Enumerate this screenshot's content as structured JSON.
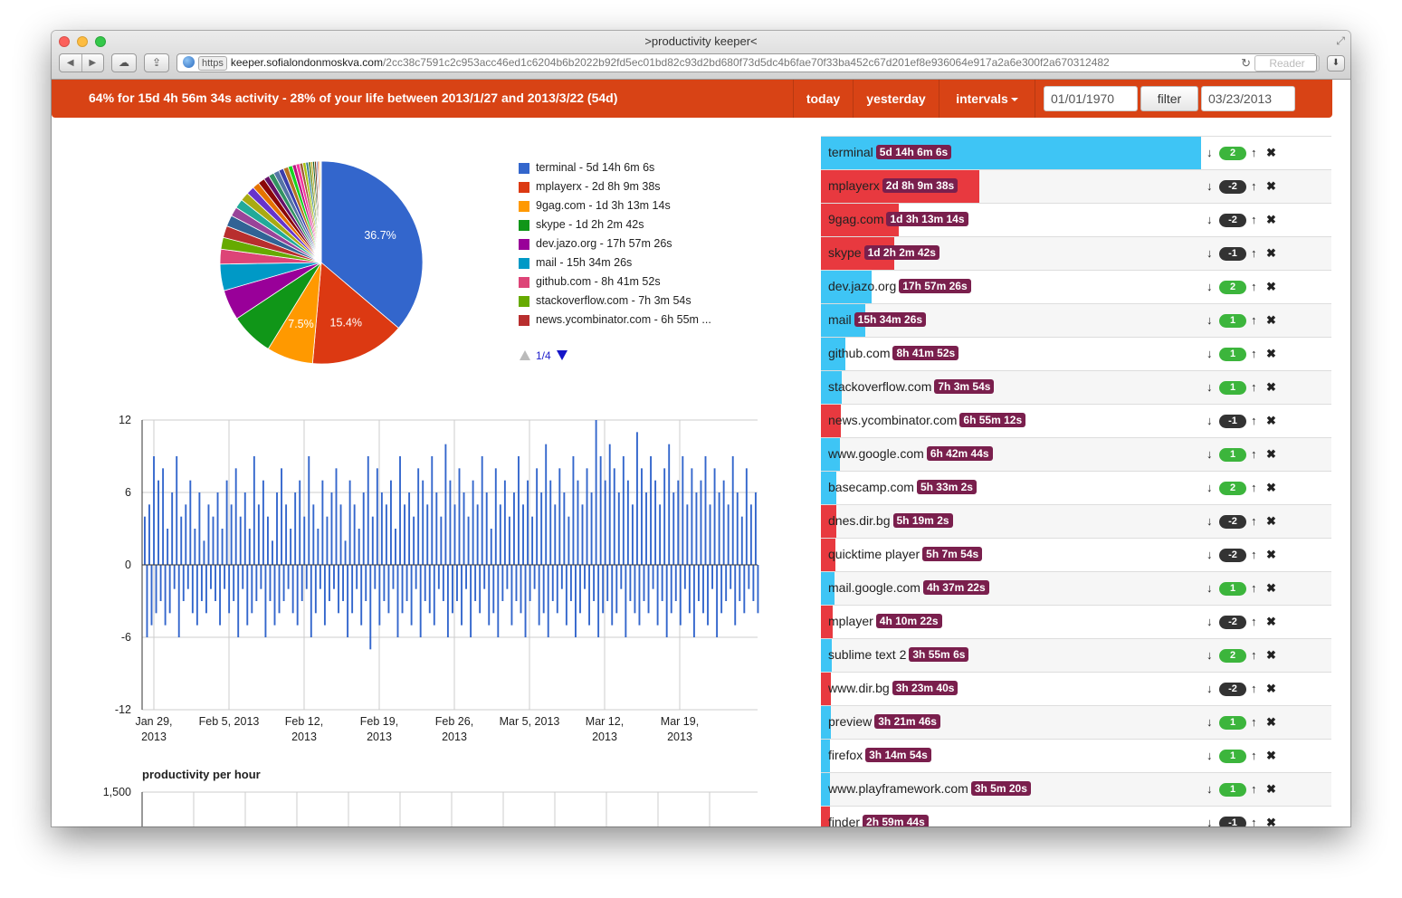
{
  "window": {
    "title": ">productivity keeper<",
    "url_https": "https",
    "url_host": "keeper.sofialondonmoskva.com",
    "url_path": "/2cc38c7591c2c953acc46ed1c6204b6b2022b92fd5ec01bd82c93d2bd680f73d5dc4b6fae70f33ba452c67d201ef8e936064e917a2a6e300f2a670312482",
    "reader": "Reader"
  },
  "topbar": {
    "summary": "64% for 15d 4h 56m 34s activity - 28% of your life between 2013/1/27 and 2013/3/22 (54d)",
    "today": "today",
    "yesterday": "yesterday",
    "intervals": "intervals",
    "from": "01/01/1970",
    "filter": "filter",
    "to": "03/23/2013"
  },
  "colors": {
    "brand": "#d84315",
    "productive": "#3ec5f5",
    "unproductive": "#e8393f",
    "duration_badge": "#7a1f4d",
    "score_positive": "#3cb53c",
    "score_negative": "#333333"
  },
  "chart_data": [
    {
      "type": "pie",
      "slices": [
        {
          "label": "terminal - 5d 14h 6m 6s",
          "value": 36.7,
          "color": "#3366cc",
          "show": "36.7%"
        },
        {
          "label": "mplayerx - 2d 8h 9m 38s",
          "value": 15.4,
          "color": "#dc3912",
          "show": "15.4%"
        },
        {
          "label": "9gag.com - 1d 3h 13m 14s",
          "value": 7.5,
          "color": "#ff9900",
          "show": "7.5%"
        },
        {
          "label": "skype - 1d 2h 2m 42s",
          "value": 7.0,
          "color": "#109618",
          "show": ""
        },
        {
          "label": "dev.jazo.org - 17h 57m 26s",
          "value": 4.9,
          "color": "#990099",
          "show": ""
        },
        {
          "label": "mail - 15h 34m 26s",
          "value": 4.3,
          "color": "#0099c6",
          "show": ""
        },
        {
          "label": "github.com - 8h 41m 52s",
          "value": 2.4,
          "color": "#dd4477",
          "show": ""
        },
        {
          "label": "stackoverflow.com - 7h 3m 54s",
          "value": 1.9,
          "color": "#66aa00",
          "show": ""
        },
        {
          "label": "news.ycombinator.com - 6h 55m ...",
          "value": 1.9,
          "color": "#b82e2e",
          "show": ""
        },
        {
          "label": "www.google.com",
          "value": 1.8,
          "color": "#316395",
          "show": ""
        },
        {
          "label": "basecamp.com",
          "value": 1.5,
          "color": "#994499",
          "show": ""
        },
        {
          "label": "dnes.dir.bg",
          "value": 1.5,
          "color": "#22aa99",
          "show": ""
        },
        {
          "label": "quicktime player",
          "value": 1.4,
          "color": "#aaaa11",
          "show": ""
        },
        {
          "label": "mail.google.com",
          "value": 1.3,
          "color": "#6633cc",
          "show": ""
        },
        {
          "label": "mplayer",
          "value": 1.1,
          "color": "#e67300",
          "show": ""
        },
        {
          "label": "sublime text 2",
          "value": 1.1,
          "color": "#8b0707",
          "show": ""
        },
        {
          "label": "www.dir.bg",
          "value": 0.9,
          "color": "#651067",
          "show": ""
        },
        {
          "label": "preview",
          "value": 0.9,
          "color": "#329262",
          "show": ""
        },
        {
          "label": "firefox",
          "value": 0.9,
          "color": "#5574a6",
          "show": ""
        },
        {
          "label": "www.playframework.com",
          "value": 0.8,
          "color": "#3b3eac",
          "show": ""
        },
        {
          "label": "finder",
          "value": 0.8,
          "color": "#b77322",
          "show": ""
        },
        {
          "label": "",
          "value": 0.7,
          "color": "#16d620",
          "show": ""
        },
        {
          "label": "",
          "value": 0.6,
          "color": "#b91383",
          "show": ""
        },
        {
          "label": "",
          "value": 0.6,
          "color": "#f4359e",
          "show": ""
        },
        {
          "label": "",
          "value": 0.5,
          "color": "#9c5935",
          "show": ""
        },
        {
          "label": "",
          "value": 0.5,
          "color": "#a9c413",
          "show": ""
        },
        {
          "label": "",
          "value": 0.4,
          "color": "#2a778d",
          "show": ""
        },
        {
          "label": "",
          "value": 0.4,
          "color": "#668d1c",
          "show": ""
        },
        {
          "label": "",
          "value": 0.3,
          "color": "#bea413",
          "show": ""
        },
        {
          "label": "",
          "value": 0.3,
          "color": "#0c5922",
          "show": ""
        },
        {
          "label": "",
          "value": 0.3,
          "color": "#743411",
          "show": ""
        },
        {
          "label": "",
          "value": 0.2,
          "color": "#3366cc",
          "show": ""
        },
        {
          "label": "",
          "value": 0.2,
          "color": "#dc3912",
          "show": ""
        },
        {
          "label": "",
          "value": 0.2,
          "color": "#ff9900",
          "show": ""
        },
        {
          "label": "",
          "value": 0.1,
          "color": "#109618",
          "show": ""
        },
        {
          "label": "",
          "value": 0.1,
          "color": "#990099",
          "show": ""
        }
      ],
      "legend_visible": 9,
      "legend_page": "1/4"
    },
    {
      "type": "bar",
      "title": "",
      "ylim": [
        -12,
        12
      ],
      "yticks": [
        "12",
        "6",
        "0",
        "-6",
        "-12"
      ],
      "xticks": [
        {
          "line1": "Jan 29,",
          "line2": "2013"
        },
        {
          "line1": "Feb 5, 2013",
          "line2": ""
        },
        {
          "line1": "Feb 12,",
          "line2": "2013"
        },
        {
          "line1": "Feb 19,",
          "line2": "2013"
        },
        {
          "line1": "Feb 26,",
          "line2": "2013"
        },
        {
          "line1": "Mar 5, 2013",
          "line2": ""
        },
        {
          "line1": "Mar 12,",
          "line2": "2013"
        },
        {
          "line1": "Mar 19,",
          "line2": "2013"
        }
      ],
      "x_start": "2013-01-28",
      "x_end": "2013-03-23",
      "bar_color": "#3366cc",
      "values": [
        4,
        -6,
        5,
        -5,
        9,
        -4,
        7,
        -3,
        8,
        -5,
        3,
        -4,
        6,
        -2,
        9,
        -6,
        4,
        -3,
        5,
        -2,
        7,
        -4,
        3,
        -5,
        6,
        -3,
        2,
        -4,
        5,
        -2,
        4,
        -3,
        6,
        -5,
        3,
        -2,
        7,
        -4,
        5,
        -3,
        8,
        -6,
        4,
        -2,
        6,
        -5,
        3,
        -4,
        9,
        -3,
        5,
        -2,
        7,
        -6,
        4,
        -3,
        2,
        -5,
        6,
        -4,
        8,
        -3,
        5,
        -2,
        3,
        -4,
        6,
        -5,
        7,
        -3,
        4,
        -2,
        9,
        -6,
        5,
        -4,
        3,
        -2,
        7,
        -5,
        4,
        -3,
        6,
        -2,
        8,
        -4,
        5,
        -3,
        2,
        -6,
        7,
        -4,
        5,
        -2,
        3,
        -5,
        6,
        -3,
        9,
        -7,
        4,
        -2,
        8,
        -5,
        6,
        -3,
        5,
        -4,
        7,
        -2,
        3,
        -6,
        9,
        -4,
        5,
        -3,
        6,
        -5,
        4,
        -2,
        8,
        -6,
        7,
        -3,
        5,
        -4,
        9,
        -5,
        6,
        -2,
        4,
        -3,
        10,
        -6,
        7,
        -4,
        5,
        -3,
        8,
        -5,
        6,
        -2,
        4,
        -6,
        7,
        -3,
        5,
        -4,
        9,
        -2,
        6,
        -5,
        3,
        -4,
        8,
        -6,
        5,
        -3,
        7,
        -2,
        4,
        -5,
        6,
        -3,
        9,
        -4,
        5,
        -6,
        7,
        -3,
        4,
        -2,
        8,
        -5,
        6,
        -4,
        10,
        -6,
        7,
        -3,
        5,
        -4,
        8,
        -2,
        6,
        -5,
        4,
        -3,
        9,
        -6,
        7,
        -4,
        5,
        -2,
        8,
        -5,
        6,
        -3,
        12,
        -6,
        9,
        -4,
        7,
        -3,
        10,
        -5,
        8,
        -4,
        6,
        -2,
        9,
        -6,
        7,
        -3,
        5,
        -4,
        11,
        -5,
        8,
        -3,
        6,
        -4,
        9,
        -2,
        7,
        -5,
        5,
        -3,
        8,
        -6,
        10,
        -4,
        6,
        -3,
        7,
        -5,
        9,
        -2,
        5,
        -4,
        8,
        -6,
        6,
        -3,
        7,
        -4,
        9,
        -5,
        5,
        -2,
        8,
        -6,
        6,
        -4,
        7,
        -3,
        5,
        -2,
        9,
        -5,
        6,
        -3,
        4,
        -4,
        8,
        -2,
        5,
        -3,
        6,
        -4
      ],
      "second_chart_title": "productivity per hour",
      "second_chart_ytick": "1,500"
    }
  ],
  "list": [
    {
      "name": "terminal",
      "dur": "5d 14h 6m 6s",
      "score": "2",
      "prod": true,
      "pct": 74.5
    },
    {
      "name": "mplayerx",
      "dur": "2d 8h 9m 38s",
      "score": "-2",
      "prod": false,
      "pct": 31.0
    },
    {
      "name": "9gag.com",
      "dur": "1d 3h 13m 14s",
      "score": "-2",
      "prod": false,
      "pct": 15.2
    },
    {
      "name": "skype",
      "dur": "1d 2h 2m 42s",
      "score": "-1",
      "prod": false,
      "pct": 14.3
    },
    {
      "name": "dev.jazo.org",
      "dur": "17h 57m 26s",
      "score": "2",
      "prod": true,
      "pct": 10.0
    },
    {
      "name": "mail",
      "dur": "15h 34m 26s",
      "score": "1",
      "prod": true,
      "pct": 8.7
    },
    {
      "name": "github.com",
      "dur": "8h 41m 52s",
      "score": "1",
      "prod": true,
      "pct": 4.8
    },
    {
      "name": "stackoverflow.com",
      "dur": "7h 3m 54s",
      "score": "1",
      "prod": true,
      "pct": 4.0
    },
    {
      "name": "news.ycombinator.com",
      "dur": "6h 55m 12s",
      "score": "-1",
      "prod": false,
      "pct": 3.9
    },
    {
      "name": "www.google.com",
      "dur": "6h 42m 44s",
      "score": "1",
      "prod": true,
      "pct": 3.8
    },
    {
      "name": "basecamp.com",
      "dur": "5h 33m 2s",
      "score": "2",
      "prod": true,
      "pct": 3.1
    },
    {
      "name": "dnes.dir.bg",
      "dur": "5h 19m 2s",
      "score": "-2",
      "prod": false,
      "pct": 3.0
    },
    {
      "name": "quicktime player",
      "dur": "5h 7m 54s",
      "score": "-2",
      "prod": false,
      "pct": 2.9
    },
    {
      "name": "mail.google.com",
      "dur": "4h 37m 22s",
      "score": "1",
      "prod": true,
      "pct": 2.6
    },
    {
      "name": "mplayer",
      "dur": "4h 10m 22s",
      "score": "-2",
      "prod": false,
      "pct": 2.3
    },
    {
      "name": "sublime text 2",
      "dur": "3h 55m 6s",
      "score": "2",
      "prod": true,
      "pct": 2.2
    },
    {
      "name": "www.dir.bg",
      "dur": "3h 23m 40s",
      "score": "-2",
      "prod": false,
      "pct": 1.9
    },
    {
      "name": "preview",
      "dur": "3h 21m 46s",
      "score": "1",
      "prod": true,
      "pct": 1.9
    },
    {
      "name": "firefox",
      "dur": "3h 14m 54s",
      "score": "1",
      "prod": true,
      "pct": 1.8
    },
    {
      "name": "www.playframework.com",
      "dur": "3h 5m 20s",
      "score": "1",
      "prod": true,
      "pct": 1.7
    },
    {
      "name": "finder",
      "dur": "2h 59m 44s",
      "score": "-1",
      "prod": false,
      "pct": 1.7
    }
  ],
  "icons": {
    "down": "arrow-down-icon",
    "up": "arrow-up-icon",
    "remove": "remove-icon"
  }
}
